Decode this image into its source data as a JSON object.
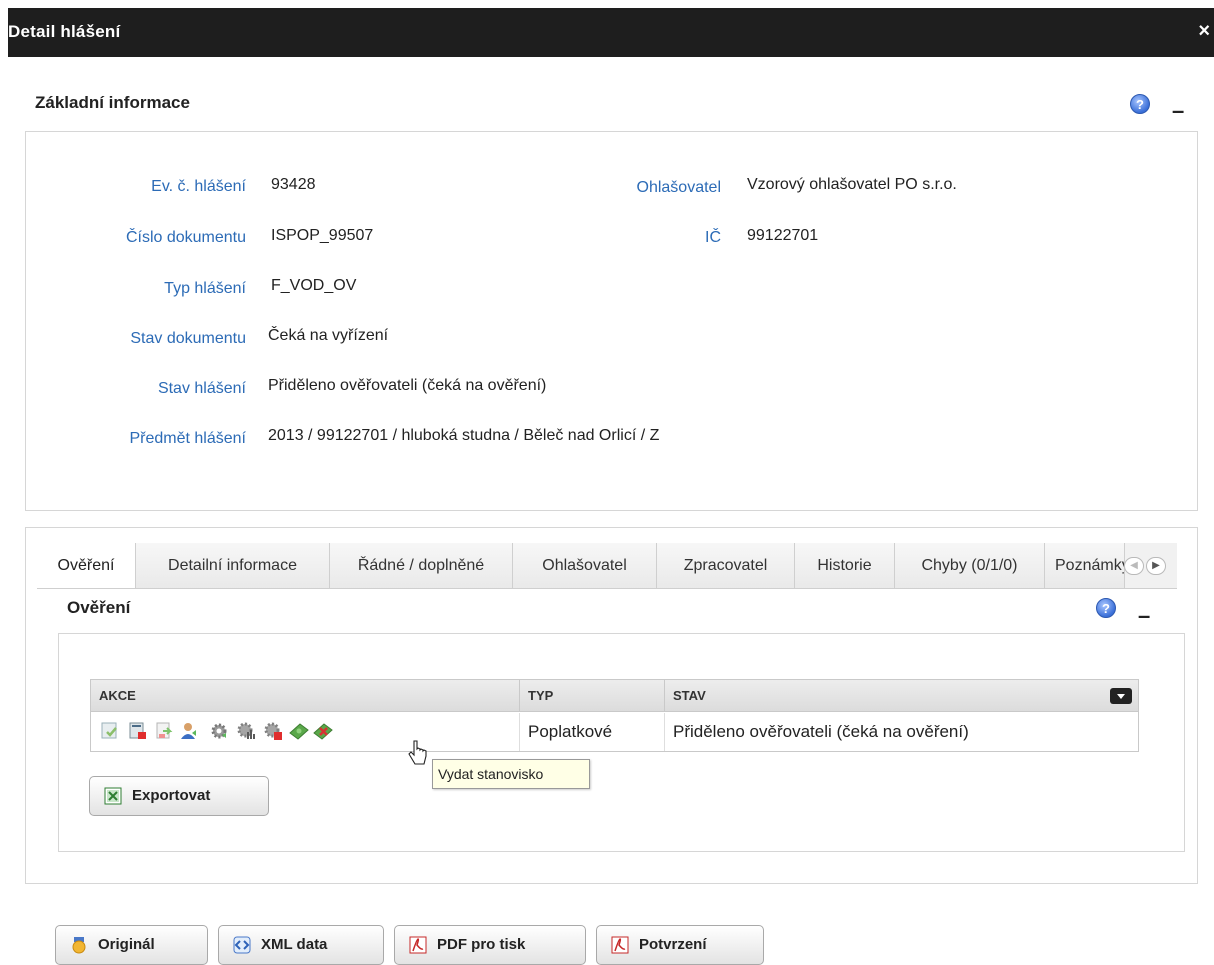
{
  "window": {
    "title": "Detail hlášení",
    "close": "×"
  },
  "basic": {
    "title": "Základní informace",
    "help": "?",
    "collapse": "–",
    "fields": {
      "ev_label": "Ev. č. hlášení",
      "ev_value": "93428",
      "doc_label": "Číslo dokumentu",
      "doc_value": "ISPOP_99507",
      "typ_label": "Typ hlášení",
      "typ_value": "F_VOD_OV",
      "stavdok_label": "Stav dokumentu",
      "stavdok_value": "Čeká na vyřízení",
      "stavhl_label": "Stav hlášení",
      "stavhl_value": "Přiděleno ověřovateli (čeká na ověření)",
      "predmet_label": "Předmět hlášení",
      "predmet_value": "2013 / 99122701 / hluboká studna / Běleč nad Orlicí / Z",
      "ohl_label": "Ohlašovatel",
      "ohl_value": "Vzorový ohlašovatel PO s.r.o.",
      "ic_label": "IČ",
      "ic_value": "99122701"
    }
  },
  "tabs": [
    {
      "label": "Ověření"
    },
    {
      "label": "Detailní informace"
    },
    {
      "label": "Řádné / doplněné"
    },
    {
      "label": "Ohlašovatel"
    },
    {
      "label": "Zpracovatel"
    },
    {
      "label": "Historie"
    },
    {
      "label": "Chyby (0/1/0)"
    },
    {
      "label": "Poznámky"
    }
  ],
  "tab_nav": {
    "prev": "◀",
    "next": "▶"
  },
  "verification": {
    "title": "Ověření",
    "help": "?",
    "collapse": "–",
    "grid": {
      "headers": {
        "akce": "AKCE",
        "typ": "TYP",
        "stav": "STAV"
      },
      "row": {
        "typ": "Poplatkové",
        "stav": "Přiděleno ověřovateli (čeká na ověření)"
      },
      "action_icons": [
        "approve-icon",
        "reject-document-icon",
        "export-document-icon",
        "assign-user-icon",
        "settings-gear-icon",
        "statistics-gear-icon",
        "delete-gear-icon",
        "money-icon",
        "issue-statement-icon"
      ]
    },
    "tooltip": "Vydat stanovisko",
    "export_label": "Exportovat"
  },
  "footer": {
    "original": "Originál",
    "xml": "XML data",
    "pdf": "PDF pro tisk",
    "confirm": "Potvrzení"
  },
  "colors": {
    "titlebar": "#1e1e1e",
    "label_blue": "#2c6bb6",
    "tooltip_bg": "#ffffe6"
  }
}
